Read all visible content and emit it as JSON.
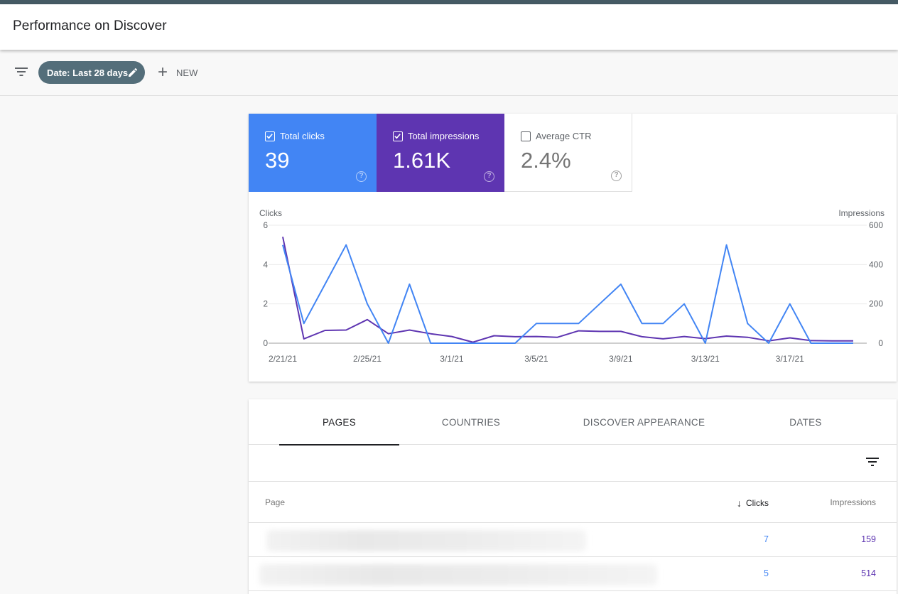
{
  "header": {
    "title": "Performance on Discover"
  },
  "filters": {
    "date_chip": "Date: Last 28 days",
    "new_label": "NEW"
  },
  "metrics": {
    "clicks": {
      "label": "Total clicks",
      "value": "39",
      "checked": true,
      "color": "#4285f4"
    },
    "impressions": {
      "label": "Total impressions",
      "value": "1.61K",
      "checked": true,
      "color": "#5e35b1"
    },
    "ctr": {
      "label": "Average CTR",
      "value": "2.4%",
      "checked": false
    },
    "help_glyph": "?"
  },
  "chart_data": {
    "type": "line",
    "x": [
      "2/21/21",
      "2/22/21",
      "2/23/21",
      "2/24/21",
      "2/25/21",
      "2/26/21",
      "2/27/21",
      "2/28/21",
      "3/1/21",
      "3/2/21",
      "3/3/21",
      "3/4/21",
      "3/5/21",
      "3/6/21",
      "3/7/21",
      "3/8/21",
      "3/9/21",
      "3/10/21",
      "3/11/21",
      "3/12/21",
      "3/13/21",
      "3/14/21",
      "3/15/21",
      "3/16/21",
      "3/17/21",
      "3/18/21",
      "3/19/21",
      "3/20/21"
    ],
    "x_tick_labels": [
      "2/21/21",
      "2/25/21",
      "3/1/21",
      "3/5/21",
      "3/9/21",
      "3/13/21",
      "3/17/21"
    ],
    "series": [
      {
        "name": "Clicks",
        "axis": "left",
        "color": "#4285f4",
        "values": [
          5,
          1,
          3,
          5,
          2,
          0,
          3,
          0,
          0,
          0,
          0,
          0,
          1,
          1,
          1,
          2,
          3,
          1,
          1,
          2,
          0,
          5,
          1,
          0,
          2,
          0,
          0,
          0
        ]
      },
      {
        "name": "Impressions",
        "axis": "right",
        "color": "#5e35b1",
        "values": [
          541,
          22,
          65,
          67,
          120,
          48,
          67,
          48,
          34,
          5,
          38,
          33,
          34,
          30,
          63,
          60,
          60,
          33,
          22,
          34,
          23,
          36,
          30,
          12,
          27,
          13,
          12,
          12
        ]
      }
    ],
    "ylabel_left": "Clicks",
    "ylabel_right": "Impressions",
    "yticks_left": [
      "0",
      "2",
      "4",
      "6"
    ],
    "yticks_right": [
      "0",
      "200",
      "400",
      "600"
    ],
    "ylim_left": [
      0,
      6
    ],
    "ylim_right": [
      0,
      600
    ],
    "grid": true
  },
  "tabs": [
    {
      "label": "PAGES",
      "active": true
    },
    {
      "label": "COUNTRIES",
      "active": false
    },
    {
      "label": "DISCOVER APPEARANCE",
      "active": false
    },
    {
      "label": "DATES",
      "active": false
    }
  ],
  "table": {
    "columns": {
      "page": "Page",
      "clicks": "Clicks",
      "impressions": "Impressions",
      "sort_arrow": "↓"
    },
    "rows": [
      {
        "page": "",
        "clicks": "7",
        "impressions": "159"
      },
      {
        "page": "",
        "clicks": "5",
        "impressions": "514"
      }
    ]
  }
}
